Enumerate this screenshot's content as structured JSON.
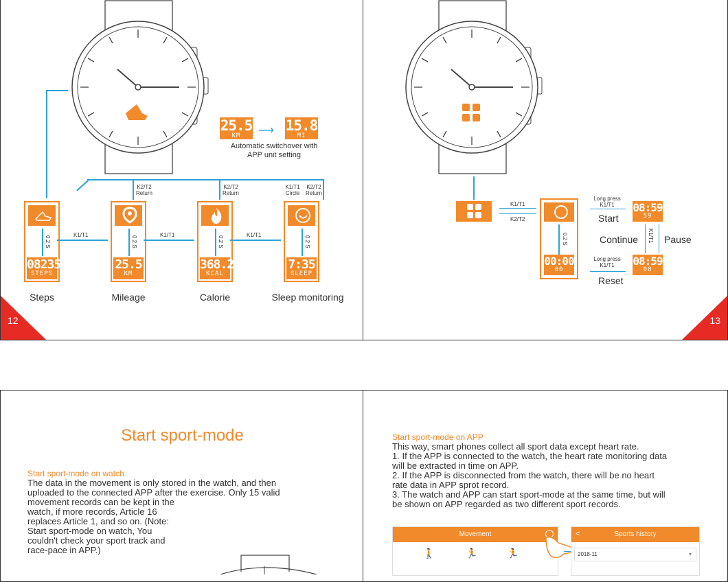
{
  "colors": {
    "accent": "#f08a2b",
    "line": "#2ba3d6"
  },
  "page12": {
    "number": "12",
    "switch": {
      "left_value": "25.5",
      "left_unit": "KM",
      "right_value": "15.8",
      "right_unit": "MI",
      "caption_line1": "Automatic switchover with",
      "caption_line2": "APP unit setting"
    },
    "labels": {
      "k2t2": "K2/T2",
      "return": "Return",
      "k1t1": "K1/T1",
      "circle": "Circle",
      "k1t1_arrow": "K1/T1",
      "duration": "0.2 S"
    },
    "cards": [
      {
        "value": "08235",
        "unit": "STEPS",
        "caption": "Steps",
        "icon": "shoe-icon"
      },
      {
        "value": "25.5",
        "unit": "KM",
        "caption": "Mileage",
        "icon": "location-pin-icon"
      },
      {
        "value": "368.2",
        "unit": "KCAL",
        "caption": "Calorie",
        "icon": "flame-icon"
      },
      {
        "value": "7:35",
        "unit": "SLEEP",
        "caption": "Sleep monitoring",
        "icon": "moon-clock-icon"
      }
    ]
  },
  "page13": {
    "number": "13",
    "k1t1": "K1/T1",
    "k2t2": "K2/T2",
    "duration": "0.2 S",
    "long_press": "Long press",
    "start": "Start",
    "continue": "Continue",
    "pause": "Pause",
    "reset": "Reset",
    "time_running": "08:59",
    "time_running_sub": "59",
    "time_paused": "08:59",
    "time_paused_sub": "08",
    "time_reset": "00:00",
    "time_reset_sub": "00"
  },
  "page14": {
    "title": "Start sport-mode",
    "subtitle": "Start sport-mode on watch",
    "line1": "The data in the movement is only stored in the watch, and then",
    "line2": "uploaded to the connected APP after the exercise. Only 15 valid",
    "line3": "movement records can be kept in the",
    "line4": "watch, if more records, Article 16",
    "line5": "replaces Article 1, and so on. (Note:",
    "line6": "Start sport-mode on watch, You",
    "line7": "couldn't check your sport track and",
    "line8": "race-pace in APP.)"
  },
  "page15": {
    "subtitle": "Start sport-mode on APP",
    "lines": [
      "This way, smart phones collect all sport data except heart rate.",
      "1. If the APP is connected to the watch, the heart rate monitoring data",
      "will be extracted in time on APP.",
      "2. If the APP is disconnected from the watch, there will be no heart",
      "rate data in APP sprot record.",
      "3. The watch and APP can start sport-mode at the same time, but will",
      "be shown on APP regarded as two different sport records."
    ],
    "phone1_title": "Movement",
    "phone2_title": "Sports history",
    "phone2_back": "<",
    "date_select": "2018-11"
  }
}
